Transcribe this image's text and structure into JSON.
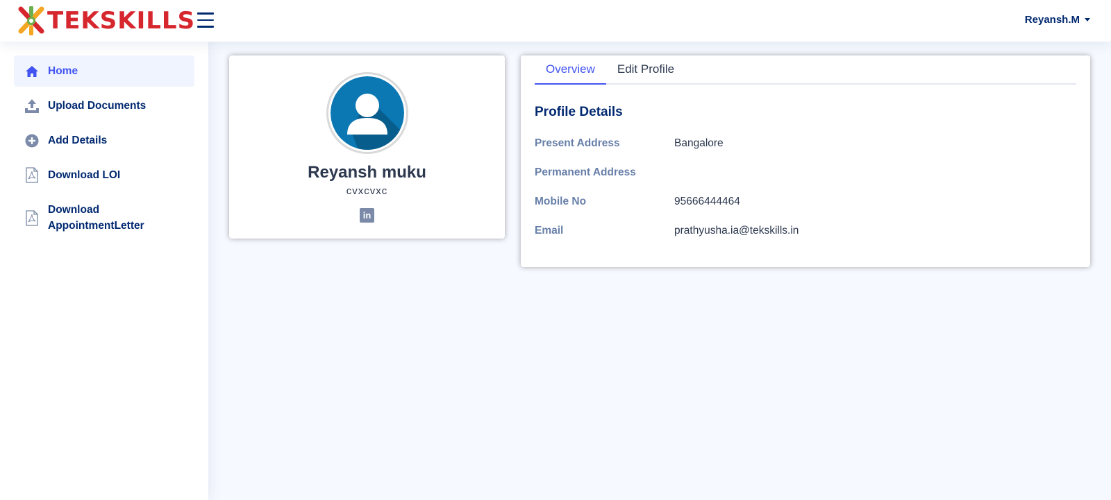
{
  "header": {
    "logo_text": "TEKSKILLS",
    "user_name": "Reyansh.M",
    "icons": {
      "menu": "hamburger-menu-icon",
      "logo": "tekskills-logo-icon",
      "dropdown": "caret-down-icon"
    },
    "colors": {
      "brand_red": "#d6272e",
      "navy": "#012970"
    }
  },
  "sidebar": {
    "items": [
      {
        "label": "Home",
        "icon": "home-icon",
        "active": true
      },
      {
        "label": "Upload Documents",
        "icon": "upload-icon",
        "active": false
      },
      {
        "label": "Add Details",
        "icon": "plus-circle-icon",
        "active": false
      },
      {
        "label": "Download LOI",
        "icon": "pdf-icon",
        "active": false
      },
      {
        "label": "Download AppointmentLetter",
        "icon": "pdf-icon",
        "active": false
      }
    ],
    "colors": {
      "active_bg": "#f0f4fe",
      "active_text": "#4154f1"
    }
  },
  "profile": {
    "name": "Reyansh muku",
    "subtitle": "cvxcvxc",
    "avatar_icon": "user-avatar-icon",
    "social_icon": "linkedin-icon"
  },
  "details": {
    "tabs": [
      {
        "label": "Overview",
        "active": true
      },
      {
        "label": "Edit Profile",
        "active": false
      }
    ],
    "section_title": "Profile Details",
    "fields": [
      {
        "label": "Present Address",
        "value": "Bangalore"
      },
      {
        "label": "Permanent Address",
        "value": ""
      },
      {
        "label": "Mobile No",
        "value": "95666444464"
      },
      {
        "label": "Email",
        "value": "prathyusha.ia@tekskills.in"
      }
    ]
  }
}
